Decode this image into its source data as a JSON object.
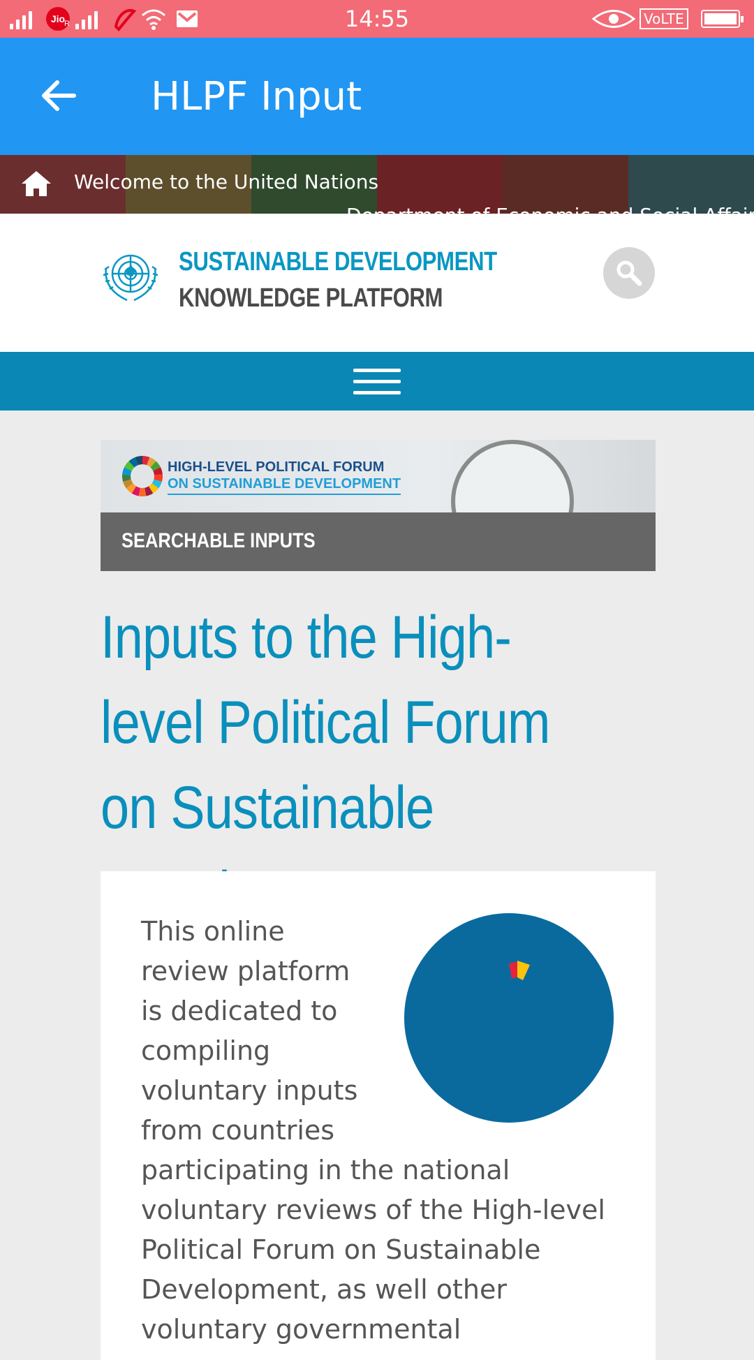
{
  "status_bar": {
    "time": "14:55",
    "carrier": "Jio",
    "network_label": "R",
    "volte": "VoLTE"
  },
  "app_bar": {
    "title": "HLPF Input"
  },
  "un_bar": {
    "welcome": "Welcome to the United Nations",
    "department": "Department of Economic and Social Affairs",
    "colors": [
      "#6b2e2e",
      "#5e4f2c",
      "#2f4a2d",
      "#6b2224",
      "#5a2b25",
      "#2f4a4d"
    ]
  },
  "site_header": {
    "title_line1": "SUSTAINABLE DEVELOPMENT",
    "title_line2": "KNOWLEDGE PLATFORM"
  },
  "banner": {
    "forum_line1": "HIGH-LEVEL POLITICAL FORUM",
    "forum_line2": "ON SUSTAINABLE DEVELOPMENT",
    "label": "SEARCHABLE INPUTS"
  },
  "page": {
    "heading": "Inputs to the High-level Political Forum on Sustainable Development",
    "intro": "This online review platform is dedicated to compiling voluntary inputs from countries participating in the national voluntary reviews of the High-level Political Forum on Sustainable Development, as well other voluntary governmental"
  },
  "colors": {
    "status_bar": "#f26b77",
    "app_bar": "#2196f3",
    "nav_bar": "#0a87b4",
    "accent": "#0a8fbc",
    "globe": "#0a6a9e"
  }
}
